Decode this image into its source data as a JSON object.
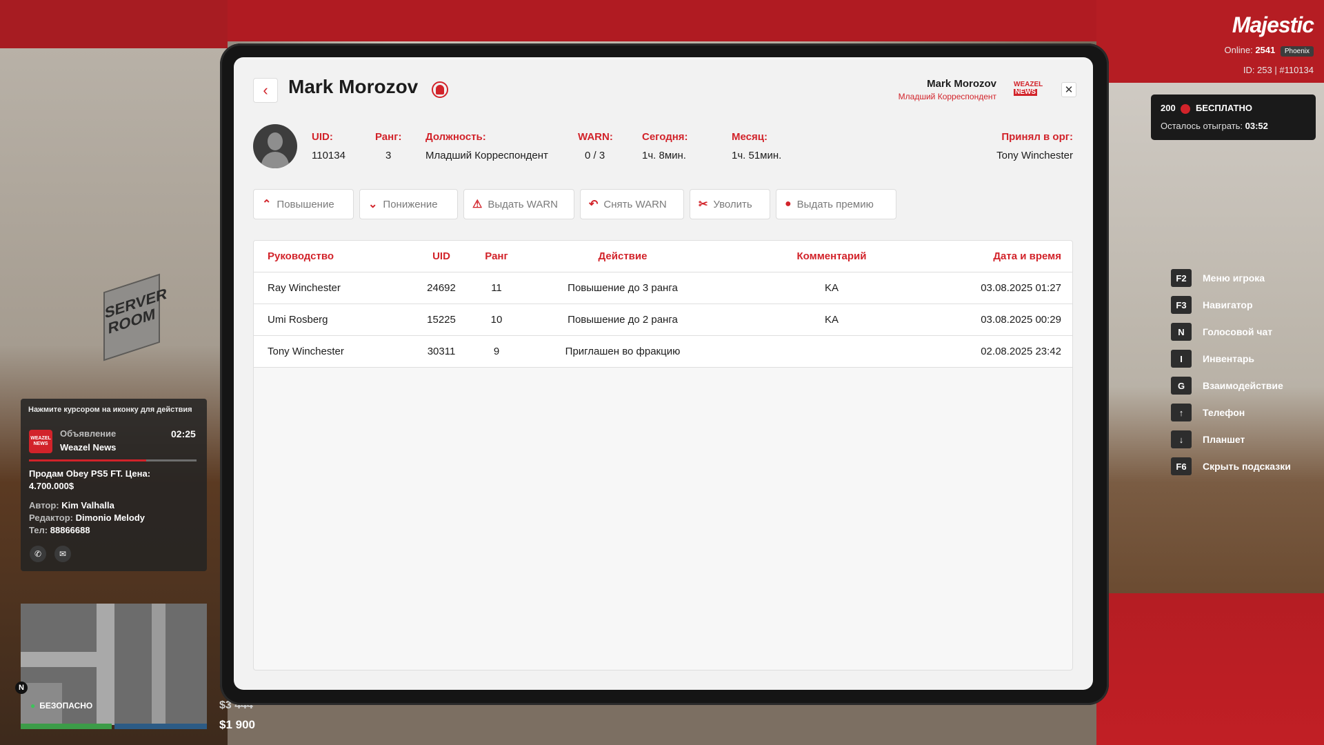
{
  "hud": {
    "logo": "Majestic",
    "online_label": "Online:",
    "online_count": "2541",
    "server": "Phoenix",
    "id_line": "ID: 253 | #110134",
    "bonus_amount": "200",
    "bonus_label": "БЕСПЛАТНО",
    "bonus_remaining_label": "Осталось отыграть:",
    "bonus_remaining_time": "03:52",
    "hints": [
      {
        "key": "F2",
        "label": "Меню игрока"
      },
      {
        "key": "F3",
        "label": "Навигатор"
      },
      {
        "key": "N",
        "label": "Голосовой чат"
      },
      {
        "key": "I",
        "label": "Инвентарь"
      },
      {
        "key": "G",
        "label": "Взаимодействие"
      },
      {
        "key": "↑",
        "label": "Телефон"
      },
      {
        "key": "↓",
        "label": "Планшет"
      },
      {
        "key": "F6",
        "label": "Скрыть подсказки"
      }
    ],
    "notification": {
      "top_hint": "Нажмите курсором на иконку для действия",
      "logo_text": "WEAZEL NEWS",
      "kind": "Объявление",
      "source": "Weazel News",
      "time": "02:25",
      "text": "Продам Obey PS5 FT. Цена: 4.700.000$",
      "author_label": "Автор:",
      "author": "Kim Valhalla",
      "editor_label": "Редактор:",
      "editor": "Dimonio Melody",
      "phone_label": "Тел:",
      "phone": "88866688"
    },
    "compass": "N",
    "zone_status": "БЕЗОПАСНО",
    "cash_bank": "$3 444",
    "cash_wallet": "$1 900"
  },
  "background": {
    "sign": "SERVER ROOM"
  },
  "tablet": {
    "back_icon": "‹",
    "title": "Mark Morozov",
    "header_user_name": "Mark Morozov",
    "header_user_rank": "Младший Корреспондент",
    "brand_line1": "WEAZEL",
    "brand_line2": "NEWS",
    "close_icon": "✕",
    "stats": {
      "uid_label": "UID:",
      "uid": "110134",
      "rank_label": "Ранг:",
      "rank": "3",
      "position_label": "Должность:",
      "position": "Младший Корреспондент",
      "warn_label": "WARN:",
      "warn": "0 / 3",
      "today_label": "Сегодня:",
      "today": "1ч. 8мин.",
      "month_label": "Месяц:",
      "month": "1ч. 51мин.",
      "accepted_label": "Принял в орг:",
      "accepted_by": "Tony Winchester"
    },
    "actions": [
      {
        "icon": "⌃",
        "label": "Повышение"
      },
      {
        "icon": "⌄",
        "label": "Понижение"
      },
      {
        "icon": "⚠",
        "label": "Выдать WARN"
      },
      {
        "icon": "↶",
        "label": "Снять WARN"
      },
      {
        "icon": "✂",
        "label": "Уволить"
      },
      {
        "icon": "●",
        "label": "Выдать премию"
      }
    ],
    "table": {
      "headers": [
        "Руководство",
        "UID",
        "Ранг",
        "Действие",
        "Комментарий",
        "Дата и время"
      ],
      "rows": [
        [
          "Ray Winchester",
          "24692",
          "11",
          "Повышение до 3 ранга",
          "KA",
          "03.08.2025 01:27"
        ],
        [
          "Umi Rosberg",
          "15225",
          "10",
          "Повышение до 2 ранга",
          "KA",
          "03.08.2025 00:29"
        ],
        [
          "Tony Winchester",
          "30311",
          "9",
          "Приглашен во фракцию",
          "",
          "02.08.2025 23:42"
        ]
      ]
    }
  },
  "colors": {
    "accent": "#d2232a",
    "panel": "#f2f2f2",
    "frame": "#151515"
  }
}
